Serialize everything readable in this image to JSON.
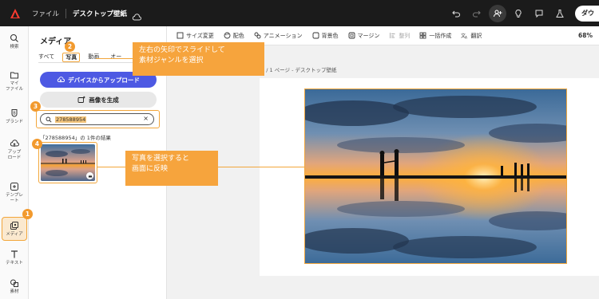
{
  "topbar": {
    "file_label": "ファイル",
    "doc_title": "デスクトップ壁紙",
    "download_label": "ダウ"
  },
  "rail": {
    "items": [
      {
        "label": "検索"
      },
      {
        "label": "マイ\nファイル"
      },
      {
        "label": "ブランド"
      },
      {
        "label": "アップ\nロード"
      },
      {
        "label": "テンプレ\nート"
      },
      {
        "label": "メディア"
      },
      {
        "label": "テキスト"
      },
      {
        "label": "素材"
      }
    ]
  },
  "panel": {
    "title": "メディア",
    "tabs": [
      "すべて",
      "写真",
      "動画",
      "オー"
    ],
    "upload_label": "デバイスからアップロード",
    "generate_label": "画像を生成",
    "search_value": "278588954",
    "results_text": "「278588954」の 1件の結果"
  },
  "toolbar": {
    "items": [
      "サイズ変更",
      "配色",
      "アニメーション",
      "背景色",
      "マージン",
      "整列",
      "一括作成",
      "翻訳"
    ],
    "zoom": "68%"
  },
  "canvas": {
    "page_label": "1 / 1 ページ - デスクトップ壁紙"
  },
  "callouts": {
    "slide": "左右の矢印でスライドして\n素材ジャンルを選択",
    "select": "写真を選択すると\n画面に反映"
  },
  "steps": [
    "1",
    "2",
    "3",
    "4"
  ],
  "colors": {
    "accent": "#f2a63b",
    "upload_button": "#4d59e3",
    "topbar": "#1b1b1b"
  }
}
